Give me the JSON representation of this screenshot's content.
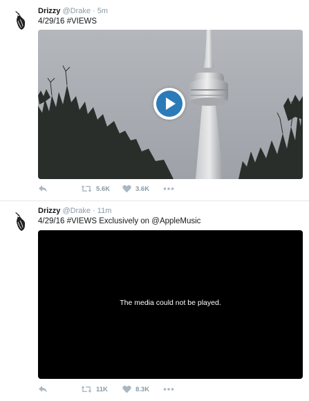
{
  "tweets": [
    {
      "name": "Drizzy",
      "handle": "@Drake",
      "separator": "·",
      "time": "5m",
      "text": "4/29/16 #VIEWS",
      "media": {
        "type": "video",
        "state": "paused",
        "play_icon": "play-icon"
      },
      "actions": {
        "reply_icon": "reply-icon",
        "retweets": "5.6K",
        "likes": "3.6K",
        "more_icon": "more-icon"
      }
    },
    {
      "name": "Drizzy",
      "handle": "@Drake",
      "separator": "·",
      "time": "11m",
      "text": "4/29/16 #VIEWS Exclusively on @AppleMusic",
      "media": {
        "type": "video",
        "state": "error",
        "message": "The media could not be played."
      },
      "actions": {
        "reply_icon": "reply-icon",
        "retweets": "11K",
        "likes": "8.3K",
        "more_icon": "more-icon"
      }
    }
  ],
  "colors": {
    "name": "#14171a",
    "secondary": "#8899a6",
    "play_button": "#2b7bb9",
    "divider": "#e1e8ed"
  }
}
